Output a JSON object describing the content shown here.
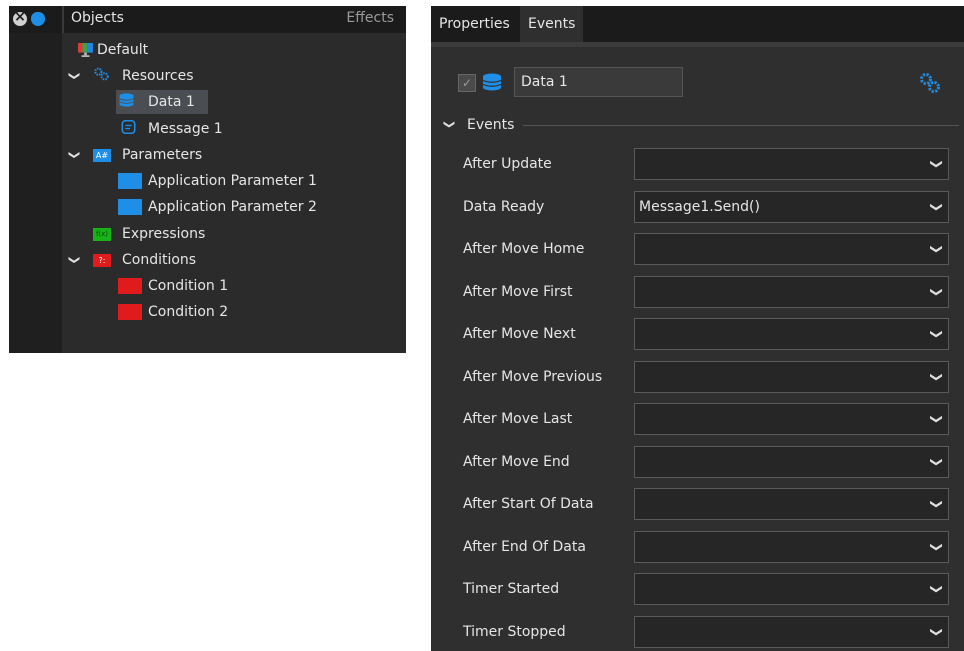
{
  "tree_panel": {
    "header": {
      "title": "Objects",
      "effects": "Effects"
    },
    "nodes": {
      "default": "Default",
      "resources": "Resources",
      "data1": "Data 1",
      "message1": "Message 1",
      "parameters": "Parameters",
      "app_param1": "Application Parameter 1",
      "app_param2": "Application Parameter 2",
      "expressions": "Expressions",
      "conditions": "Conditions",
      "condition1": "Condition 1",
      "condition2": "Condition 2"
    },
    "icon_badges": {
      "parameters": "A#",
      "expressions": "f(x)",
      "conditions": "?:"
    }
  },
  "props_panel": {
    "tabs": [
      "Properties",
      "Events"
    ],
    "active_tab": "Events",
    "object_name": "Data 1",
    "section_title": "Events",
    "events": [
      {
        "label": "After Update",
        "value": ""
      },
      {
        "label": "Data Ready",
        "value": "Message1.Send()"
      },
      {
        "label": "After Move Home",
        "value": ""
      },
      {
        "label": "After Move First",
        "value": ""
      },
      {
        "label": "After Move Next",
        "value": ""
      },
      {
        "label": "After Move Previous",
        "value": ""
      },
      {
        "label": "After Move Last",
        "value": ""
      },
      {
        "label": "After Move End",
        "value": ""
      },
      {
        "label": "After Start Of Data",
        "value": ""
      },
      {
        "label": "After End Of Data",
        "value": ""
      },
      {
        "label": "Timer Started",
        "value": ""
      },
      {
        "label": "Timer Stopped",
        "value": ""
      }
    ]
  },
  "colors": {
    "panel_bg": "#2b2b2b",
    "header_bg": "#1b1b1b",
    "accent_blue": "#1f8ee6",
    "condition_red": "#e01b1b",
    "expression_green": "#17b317"
  }
}
